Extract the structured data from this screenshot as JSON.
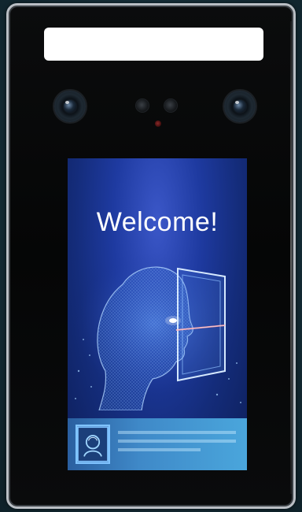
{
  "device": {
    "type": "face-recognition-terminal",
    "frame_color": "#050606",
    "bezel_color": "#b9bec4"
  },
  "screen": {
    "welcome_text": "Welcome!",
    "background_color": "#1e3aa0"
  },
  "icons": {
    "camera_left": "camera-icon",
    "camera_right": "camera-icon",
    "face_scan": "face-scan-icon",
    "user_id": "user-id-icon"
  }
}
